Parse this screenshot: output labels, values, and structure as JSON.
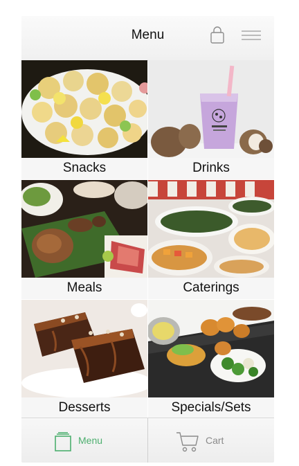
{
  "header": {
    "title": "Menu",
    "bag_icon": "shopping-bag-icon",
    "menu_icon": "hamburger-menu-icon"
  },
  "categories": [
    {
      "label": "Snacks"
    },
    {
      "label": "Drinks"
    },
    {
      "label": "Meals"
    },
    {
      "label": "Caterings"
    },
    {
      "label": "Desserts"
    },
    {
      "label": "Specials/Sets"
    }
  ],
  "tabbar": {
    "menu_label": "Menu",
    "cart_label": "Cart",
    "menu_icon": "menu-tab-icon",
    "cart_icon": "cart-icon",
    "active_color": "#4caf6e",
    "inactive_color": "#8a8a8a"
  }
}
